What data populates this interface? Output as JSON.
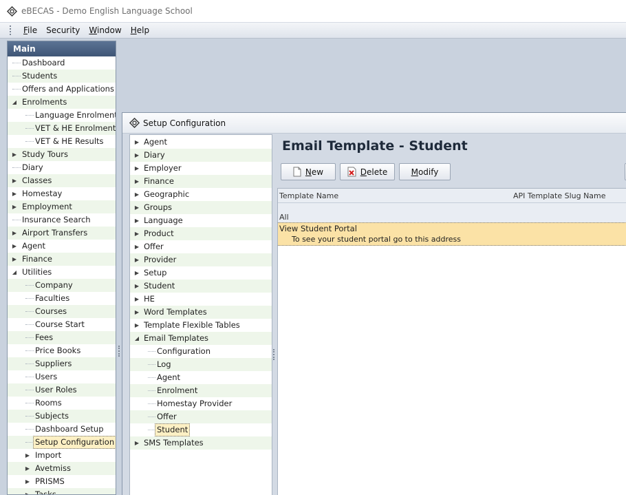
{
  "app": {
    "title": "eBECAS - Demo English Language School"
  },
  "menu": [
    {
      "label": "File",
      "u": "F",
      "rest": "ile"
    },
    {
      "label": "Security",
      "u": "",
      "rest": "Security"
    },
    {
      "label": "Window",
      "u": "W",
      "rest": "indow"
    },
    {
      "label": "Help",
      "u": "H",
      "rest": "elp"
    }
  ],
  "sidebar": {
    "header": "Main",
    "items": [
      {
        "label": "Dashboard",
        "level": 0,
        "expander": ""
      },
      {
        "label": "Students",
        "level": 0,
        "expander": ""
      },
      {
        "label": "Offers and Applications",
        "level": 0,
        "expander": ""
      },
      {
        "label": "Enrolments",
        "level": 0,
        "expander": "open"
      },
      {
        "label": "Language Enrolments",
        "level": 1,
        "expander": ""
      },
      {
        "label": "VET & HE Enrolments",
        "level": 1,
        "expander": ""
      },
      {
        "label": "VET & HE Results",
        "level": 1,
        "expander": ""
      },
      {
        "label": "Study Tours",
        "level": 0,
        "expander": "closed"
      },
      {
        "label": "Diary",
        "level": 0,
        "expander": ""
      },
      {
        "label": "Classes",
        "level": 0,
        "expander": "closed"
      },
      {
        "label": "Homestay",
        "level": 0,
        "expander": "closed"
      },
      {
        "label": "Employment",
        "level": 0,
        "expander": "closed"
      },
      {
        "label": "Insurance Search",
        "level": 0,
        "expander": ""
      },
      {
        "label": "Airport Transfers",
        "level": 0,
        "expander": "closed"
      },
      {
        "label": "Agent",
        "level": 0,
        "expander": "closed"
      },
      {
        "label": "Finance",
        "level": 0,
        "expander": "closed"
      },
      {
        "label": "Utilities",
        "level": 0,
        "expander": "open"
      },
      {
        "label": "Company",
        "level": 1,
        "expander": ""
      },
      {
        "label": "Faculties",
        "level": 1,
        "expander": ""
      },
      {
        "label": "Courses",
        "level": 1,
        "expander": ""
      },
      {
        "label": "Course Start",
        "level": 1,
        "expander": ""
      },
      {
        "label": "Fees",
        "level": 1,
        "expander": ""
      },
      {
        "label": "Price Books",
        "level": 1,
        "expander": ""
      },
      {
        "label": "Suppliers",
        "level": 1,
        "expander": ""
      },
      {
        "label": "Users",
        "level": 1,
        "expander": ""
      },
      {
        "label": "User Roles",
        "level": 1,
        "expander": ""
      },
      {
        "label": "Rooms",
        "level": 1,
        "expander": ""
      },
      {
        "label": "Subjects",
        "level": 1,
        "expander": ""
      },
      {
        "label": "Dashboard Setup",
        "level": 1,
        "expander": ""
      },
      {
        "label": "Setup Configuration",
        "level": 1,
        "expander": "",
        "selected": true
      },
      {
        "label": "Import",
        "level": 1,
        "expander": "closed"
      },
      {
        "label": "Avetmiss",
        "level": 1,
        "expander": "closed"
      },
      {
        "label": "PRISMS",
        "level": 1,
        "expander": "closed"
      },
      {
        "label": "Tasks",
        "level": 1,
        "expander": "closed"
      }
    ]
  },
  "setup_window": {
    "title": "Setup Configuration",
    "tree": [
      {
        "label": "Agent",
        "level": 0,
        "expander": "closed"
      },
      {
        "label": "Diary",
        "level": 0,
        "expander": "closed"
      },
      {
        "label": "Employer",
        "level": 0,
        "expander": "closed"
      },
      {
        "label": "Finance",
        "level": 0,
        "expander": "closed"
      },
      {
        "label": "Geographic",
        "level": 0,
        "expander": "closed"
      },
      {
        "label": "Groups",
        "level": 0,
        "expander": "closed"
      },
      {
        "label": "Language",
        "level": 0,
        "expander": "closed"
      },
      {
        "label": "Product",
        "level": 0,
        "expander": "closed"
      },
      {
        "label": "Offer",
        "level": 0,
        "expander": "closed"
      },
      {
        "label": "Provider",
        "level": 0,
        "expander": "closed"
      },
      {
        "label": "Setup",
        "level": 0,
        "expander": "closed"
      },
      {
        "label": "Student",
        "level": 0,
        "expander": "closed"
      },
      {
        "label": "HE",
        "level": 0,
        "expander": "closed"
      },
      {
        "label": "Word Templates",
        "level": 0,
        "expander": "closed"
      },
      {
        "label": "Template Flexible Tables",
        "level": 0,
        "expander": "closed"
      },
      {
        "label": "Email Templates",
        "level": 0,
        "expander": "open"
      },
      {
        "label": "Configuration",
        "level": 1,
        "expander": ""
      },
      {
        "label": "Log",
        "level": 1,
        "expander": ""
      },
      {
        "label": "Agent",
        "level": 1,
        "expander": ""
      },
      {
        "label": "Enrolment",
        "level": 1,
        "expander": ""
      },
      {
        "label": "Homestay Provider",
        "level": 1,
        "expander": ""
      },
      {
        "label": "Offer",
        "level": 1,
        "expander": ""
      },
      {
        "label": "Student",
        "level": 1,
        "expander": "",
        "selected": true
      },
      {
        "label": "SMS Templates",
        "level": 0,
        "expander": "closed"
      }
    ],
    "panel_title": "Email Template - Student",
    "buttons": {
      "new_u": "N",
      "new_rest": "ew",
      "delete_u": "D",
      "delete_rest": "elete",
      "modify_u": "M",
      "modify_rest": "odify"
    },
    "grid": {
      "columns": [
        "Template Name",
        "API Template Slug Name"
      ],
      "filter": "All",
      "row_name": "View Student Portal",
      "row_preview": "To see your student portal go to this address"
    }
  }
}
